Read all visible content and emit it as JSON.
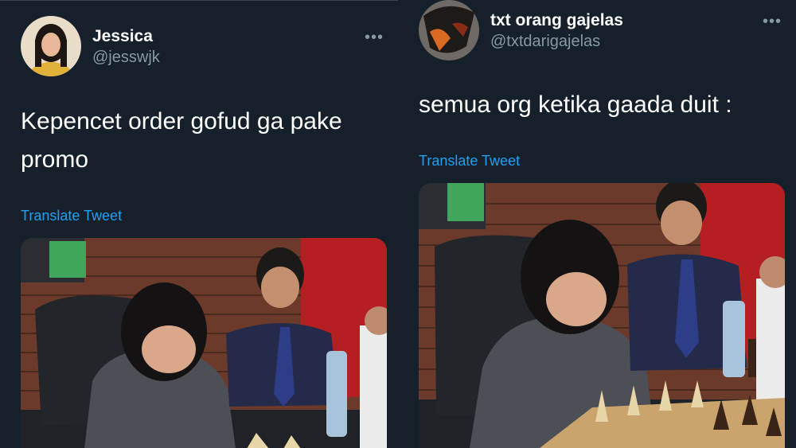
{
  "tweets": [
    {
      "display_name": "Jessica",
      "handle": "@jesswjk",
      "more_icon": "more-horizontal-icon",
      "text": "Kepencet order gofud ga pake promo",
      "translate_label": "Translate Tweet"
    },
    {
      "display_name": "txt orang gajelas",
      "handle": "@txtdarigajelas",
      "more_icon": "more-horizontal-icon",
      "text": "semua org ketika gaada duit :",
      "translate_label": "Translate Tweet"
    }
  ],
  "colors": {
    "background": "#15202b",
    "secondary_text": "#8899a6",
    "link": "#1da1f2"
  }
}
